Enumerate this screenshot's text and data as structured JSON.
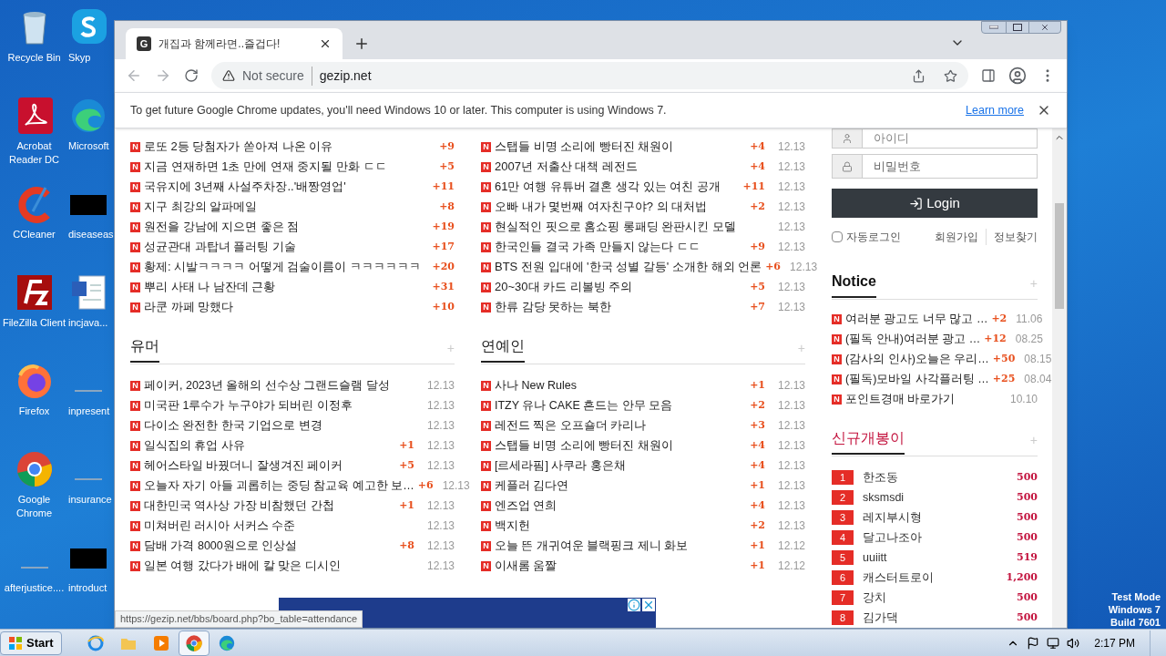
{
  "desktop": {
    "icons": [
      {
        "label": "Recycle Bin",
        "kind": "recycle"
      },
      {
        "label": "Skyp",
        "kind": "skype"
      },
      {
        "label": "Acrobat Reader DC",
        "kind": "acrobat"
      },
      {
        "label": "Microsoft",
        "kind": "edge"
      },
      {
        "label": "CCleaner",
        "kind": "ccleaner"
      },
      {
        "label": "diseaseas",
        "kind": "dark"
      },
      {
        "label": "FileZilla Client",
        "kind": "filezilla"
      },
      {
        "label": "incjava...",
        "kind": "word"
      },
      {
        "label": "Firefox",
        "kind": "firefox"
      },
      {
        "label": "inpresent",
        "kind": "blank"
      },
      {
        "label": "Google Chrome",
        "kind": "chrome"
      },
      {
        "label": "insurance",
        "kind": "blank"
      },
      {
        "label": "afterjustice....",
        "kind": "blank"
      },
      {
        "label": "introduct",
        "kind": "dark"
      }
    ],
    "mode_text": [
      "Test Mode",
      "Windows 7",
      "Build 7601"
    ]
  },
  "browser": {
    "tab": {
      "favicon": "G",
      "title": "개집과 함께라면..즐겁다!",
      "selected": true
    },
    "address": {
      "security": "Not secure",
      "url": "gezip.net"
    },
    "infobar": {
      "message": "To get future Google Chrome updates, you'll need Windows 10 or later. This computer is using Windows 7.",
      "link": "Learn more"
    },
    "status_url": "https://gezip.net/bbs/board.php?bo_table=attendance"
  },
  "top_lists": [
    {
      "rows": [
        {
          "badge": "N",
          "title": "로또 2등 당첨자가 쏟아져 나온 이유",
          "count": "+9"
        },
        {
          "badge": "N",
          "title": "지금 연재하면 1초 만에 연재 중지될 만화 ㄷㄷ",
          "count": "+5"
        },
        {
          "badge": "N",
          "title": "국유지에 3년째 사설주차장..'배짱영업'",
          "count": "+11"
        },
        {
          "badge": "N",
          "title": "지구 최강의 알파메일",
          "count": "+8"
        },
        {
          "badge": "N",
          "title": "원전을 강남에 지으면 좋은 점",
          "count": "+19"
        },
        {
          "badge": "N",
          "title": "성균관대 과탑녀 플러팅 기술",
          "count": "+17"
        },
        {
          "badge": "N",
          "title": "황제: 시발ㅋㅋㅋㅋ 어떻게 검술이름이 ㅋㅋㅋㅋㅋㅋ",
          "count": "+20"
        },
        {
          "badge": "N",
          "title": "뿌리 사태 나 남잔데 근황",
          "count": "+31"
        },
        {
          "badge": "N",
          "title": "라쿤 까페 망했다",
          "count": "+10"
        }
      ]
    },
    {
      "rows": [
        {
          "badge": "N",
          "title": "스탭들 비명 소리에 빵터진 채원이",
          "count": "+4",
          "date": "12.13"
        },
        {
          "badge": "N",
          "title": "2007년 저출산 대책 레전드",
          "count": "+4",
          "date": "12.13"
        },
        {
          "badge": "N",
          "title": "61만 여행 유튜버 결혼 생각 있는 여친 공개",
          "count": "+11",
          "date": "12.13"
        },
        {
          "badge": "N",
          "title": "오빠 내가 몇번째 여자친구야? 의 대처법",
          "count": "+2",
          "date": "12.13"
        },
        {
          "badge": "N",
          "title": "현실적인 핏으로 홈쇼핑 롱패딩 완판시킨 모델",
          "date": "12.13"
        },
        {
          "badge": "N",
          "title": "한국인들 결국 가족 만들지 않는다 ㄷㄷ",
          "count": "+9",
          "date": "12.13"
        },
        {
          "badge": "N",
          "title": "BTS 전원 입대에 '한국 성별 갈등' 소개한 해외 언론",
          "count": "+6",
          "date": "12.13"
        },
        {
          "badge": "N",
          "title": "20~30대 카드 리볼빙 주의",
          "count": "+5",
          "date": "12.13"
        },
        {
          "badge": "N",
          "title": "한류 감당 못하는 북한",
          "count": "+7",
          "date": "12.13"
        }
      ]
    }
  ],
  "boards": [
    {
      "title": "유머",
      "more": "+",
      "rows": [
        {
          "badge": "N",
          "title": "페이커, 2023년 올해의 선수상 그랜드슬램 달성",
          "date": "12.13"
        },
        {
          "badge": "N",
          "title": "미국판 1루수가 누구야가 되버린 이정후",
          "date": "12.13"
        },
        {
          "badge": "N",
          "title": "다이소 완전한 한국 기업으로 변경",
          "date": "12.13"
        },
        {
          "badge": "N",
          "title": "일식집의 휴업 사유",
          "count": "+1",
          "date": "12.13"
        },
        {
          "badge": "N",
          "title": "헤어스타일 바꿨더니 잘생겨진 페이커",
          "count": "+5",
          "date": "12.13"
        },
        {
          "badge": "N",
          "title": "오늘자 자기 아들 괴롭히는 중딩 참교육 예고한 보…",
          "count": "+6",
          "date": "12.13"
        },
        {
          "badge": "N",
          "title": "대한민국 역사상 가장 비참했던 간첩",
          "count": "+1",
          "date": "12.13"
        },
        {
          "badge": "N",
          "title": "미쳐버린 러시아 서커스 수준",
          "date": "12.13"
        },
        {
          "badge": "N",
          "title": "담배 가격 8000원으로 인상설",
          "count": "+8",
          "date": "12.13"
        },
        {
          "badge": "N",
          "title": "일본 여행 갔다가 배에 칼 맞은 디시인",
          "date": "12.13"
        }
      ]
    },
    {
      "title": "연예인",
      "more": "+",
      "rows": [
        {
          "badge": "N",
          "title": "사나 New Rules",
          "count": "+1",
          "date": "12.13"
        },
        {
          "badge": "N",
          "title": "ITZY 유나 CAKE 흔드는 안무 모음",
          "count": "+2",
          "date": "12.13"
        },
        {
          "badge": "N",
          "title": "레전드 찍은 오프숄더 카리나",
          "count": "+3",
          "date": "12.13"
        },
        {
          "badge": "N",
          "title": "스탭들 비명 소리에 빵터진 채원이",
          "count": "+4",
          "date": "12.13"
        },
        {
          "badge": "N",
          "title": "[르세라핌] 사쿠라 홍은채",
          "count": "+4",
          "date": "12.13"
        },
        {
          "badge": "N",
          "title": "케플러 김다연",
          "count": "+1",
          "date": "12.13"
        },
        {
          "badge": "N",
          "title": "엔즈업 연희",
          "count": "+4",
          "date": "12.13"
        },
        {
          "badge": "N",
          "title": "백지헌",
          "count": "+2",
          "date": "12.13"
        },
        {
          "badge": "N",
          "title": "오늘 뜬 개귀여운 블랙핑크 제니 화보",
          "count": "+1",
          "date": "12.12"
        },
        {
          "badge": "N",
          "title": "이새롬 움짤",
          "count": "+1",
          "date": "12.12"
        }
      ]
    }
  ],
  "sidebar": {
    "login": {
      "id_placeholder": "아이디",
      "pw_placeholder": "비밀번호",
      "button": "Login",
      "auto_login": {
        "label": "자동로그인",
        "checked": false
      },
      "links": [
        "회원가입",
        "정보찾기"
      ]
    },
    "notice": {
      "title": "Notice",
      "more": "+",
      "rows": [
        {
          "badge": "N",
          "title": "여러분 광고도 너무 많고 …",
          "count": "+2",
          "date": "11.06"
        },
        {
          "badge": "N",
          "title": "(필독 안내)여러분 광고 …",
          "count": "+12",
          "date": "08.25"
        },
        {
          "badge": "N",
          "title": "(감사의 인사)오늘은 우리…",
          "count": "+50",
          "date": "08.15"
        },
        {
          "badge": "N",
          "title": "(필독)모바일 사각플러팅 …",
          "count": "+25",
          "date": "08.04"
        },
        {
          "badge": "N",
          "title": "포인트경매 바로가기",
          "date": "10.10"
        }
      ]
    },
    "ranking": {
      "title": "신규개봉이",
      "more": "+",
      "rows": [
        {
          "rank": "1",
          "name": "한조동",
          "points": "500"
        },
        {
          "rank": "2",
          "name": "sksmsdi",
          "points": "500"
        },
        {
          "rank": "3",
          "name": "레지부시형",
          "points": "500"
        },
        {
          "rank": "4",
          "name": "달고나조아",
          "points": "500"
        },
        {
          "rank": "5",
          "name": "uuiitt",
          "points": "519"
        },
        {
          "rank": "6",
          "name": "캐스터트로이",
          "points": "1,200"
        },
        {
          "rank": "7",
          "name": "강치",
          "points": "500"
        },
        {
          "rank": "8",
          "name": "김가댁",
          "points": "500"
        }
      ]
    }
  },
  "taskbar": {
    "start": "Start",
    "apps": [
      {
        "kind": "ie",
        "selected": false
      },
      {
        "kind": "folder",
        "selected": false
      },
      {
        "kind": "media",
        "selected": false
      },
      {
        "kind": "chrome",
        "selected": true
      },
      {
        "kind": "edge",
        "selected": false
      }
    ],
    "time": "2:17 PM"
  }
}
